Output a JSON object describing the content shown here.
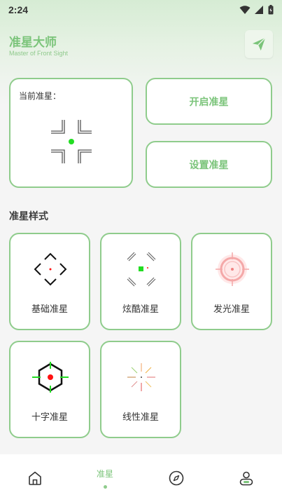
{
  "status_bar": {
    "time": "2:24"
  },
  "header": {
    "title": "准星大师",
    "subtitle": "Master of Front Sight",
    "share_icon": "paper-plane-icon"
  },
  "current": {
    "label": "当前准星："
  },
  "actions": {
    "open_label": "开启准星",
    "settings_label": "设置准星"
  },
  "styles_section": {
    "title": "准星样式",
    "items": [
      {
        "label": "基础准星"
      },
      {
        "label": "炫酷准星"
      },
      {
        "label": "发光准星"
      },
      {
        "label": "十字准星"
      },
      {
        "label": "线性准星"
      }
    ]
  },
  "nav": {
    "items": [
      {
        "icon": "home-icon"
      },
      {
        "label": "准星",
        "active": true
      },
      {
        "icon": "compass-icon"
      },
      {
        "icon": "profile-icon"
      }
    ]
  },
  "colors": {
    "accent": "#7bc47a",
    "border": "#8fcc8c",
    "crosshair_green": "#22dd22",
    "crosshair_red": "#ff1111"
  }
}
